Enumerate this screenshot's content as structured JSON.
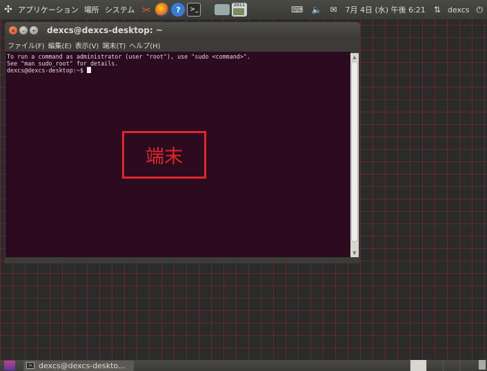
{
  "top_panel": {
    "menus": [
      "アプリケーション",
      "場所",
      "システム"
    ],
    "launchers": [
      "tool-icon",
      "firefox-icon",
      "help-icon",
      "terminal-icon",
      "screenshot-icon",
      "image-viewer-icon"
    ],
    "image_year": "2011",
    "tray": {
      "keyboard_icon": "⌨",
      "volume_icon": "🔈",
      "mail_icon": "✉",
      "clock": "7月 4日 (水) 午後 6:21",
      "network_icon": "⇅",
      "user_name": "dexcs",
      "power_icon": "⏻"
    }
  },
  "terminal": {
    "title": "dexcs@dexcs-desktop: ~",
    "menus": [
      "ファイル(F)",
      "編集(E)",
      "表示(V)",
      "端末(T)",
      "ヘルプ(H)"
    ],
    "lines": [
      "To run a command as administrator (user \"root\"), use \"sudo <command>\".",
      "See \"man sudo_root\" for details.",
      "",
      "dexcs@dexcs-desktop:~$ "
    ]
  },
  "annotation": {
    "label": "端末",
    "color": "#e0282a"
  },
  "bottom_panel": {
    "task_label": "dexcs@dexcs-deskto..."
  },
  "colors": {
    "terminal_bg": "#2c0a1f",
    "panel_bg": "#3c3b37",
    "grid_line": "#962832"
  }
}
